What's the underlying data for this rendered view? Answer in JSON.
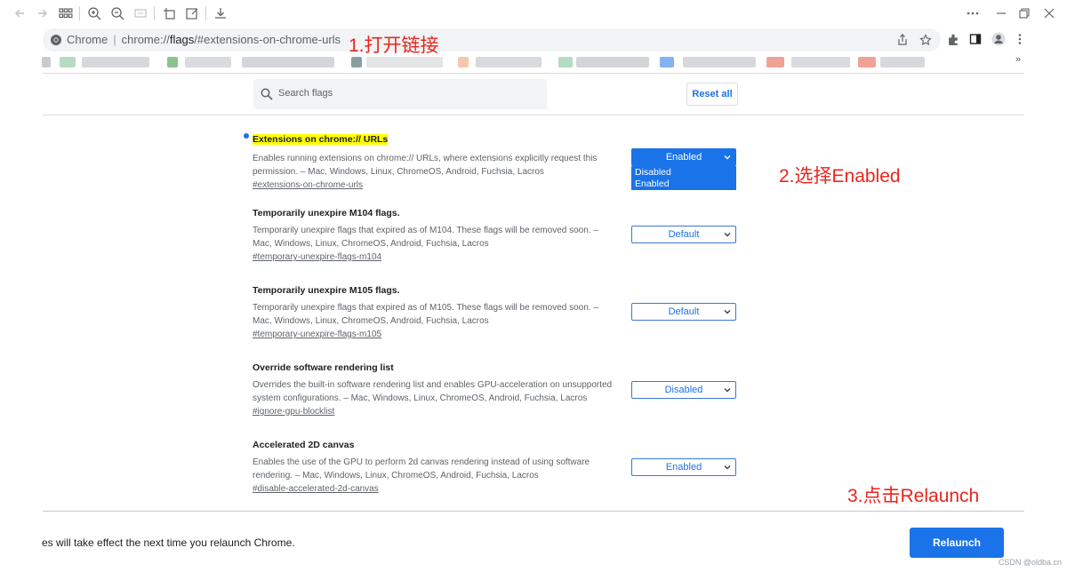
{
  "browser": {
    "address_label": "Chrome",
    "url_prefix": "chrome://",
    "url_host": "flags",
    "url_rest": "/#extensions-on-chrome-urls",
    "more_bookmarks": "»"
  },
  "flags_page": {
    "search_placeholder": "Search flags",
    "reset_label": "Reset all",
    "items": [
      {
        "title": "Extensions on chrome:// URLs",
        "desc": "Enables running extensions on chrome:// URLs, where extensions explicitly request this permission. – Mac, Windows, Linux, ChromeOS, Android, Fuchsia, Lacros",
        "link": "#extensions-on-chrome-urls",
        "value": "Enabled",
        "modified": true
      },
      {
        "title": "Temporarily unexpire M104 flags.",
        "desc": "Temporarily unexpire flags that expired as of M104. These flags will be removed soon. – Mac, Windows, Linux, ChromeOS, Android, Fuchsia, Lacros",
        "link": "#temporary-unexpire-flags-m104",
        "value": "Default"
      },
      {
        "title": "Temporarily unexpire M105 flags.",
        "desc": "Temporarily unexpire flags that expired as of M105. These flags will be removed soon. – Mac, Windows, Linux, ChromeOS, Android, Fuchsia, Lacros",
        "link": "#temporary-unexpire-flags-m105",
        "value": "Default"
      },
      {
        "title": "Override software rendering list",
        "desc": "Overrides the built-in software rendering list and enables GPU-acceleration on unsupported system configurations. – Mac, Windows, Linux, ChromeOS, Android, Fuchsia, Lacros",
        "link": "#ignore-gpu-blocklist",
        "value": "Disabled"
      },
      {
        "title": "Accelerated 2D canvas",
        "desc": "Enables the use of the GPU to perform 2d canvas rendering instead of using software rendering. – Mac, Windows, Linux, ChromeOS, Android, Fuchsia, Lacros",
        "link": "#disable-accelerated-2d-canvas",
        "value": "Enabled"
      }
    ],
    "dropdown_options": [
      "Disabled",
      "Enabled"
    ]
  },
  "annotations": {
    "step1": "1.打开链接",
    "step2": "2.选择Enabled",
    "step3": "3.点击Relaunch"
  },
  "footer": {
    "message": "es will take effect the next time you relaunch Chrome.",
    "relaunch_label": "Relaunch"
  },
  "watermark": "CSDN @oldba.cn",
  "colors": {
    "accent": "#1a73e8",
    "annotation": "#e8261c",
    "highlight": "#ffff00"
  }
}
